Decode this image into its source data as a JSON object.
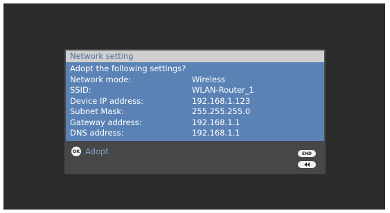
{
  "dialog": {
    "title": "Network setting",
    "question": "Adopt the following settings?",
    "rows": [
      {
        "label": "Network mode:",
        "value": "Wireless"
      },
      {
        "label": "SSID:",
        "value": "WLAN-Router_1"
      },
      {
        "label": "Device IP address:",
        "value": "192.168.1.123"
      },
      {
        "label": "Subnet Mask:",
        "value": "255.255.255.0"
      },
      {
        "label": "Gateway address:",
        "value": "192.168.1.1"
      },
      {
        "label": "DNS address:",
        "value": "192.168.1.1"
      }
    ]
  },
  "footer": {
    "ok_icon_label": "OK",
    "adopt_label": "Adopt",
    "end_label": "END",
    "back_icon": "rewind-back-icon"
  },
  "colors": {
    "screen_bg": "#2b2b2b",
    "dialog_bg": "#474747",
    "title_bg": "#cfcfcf",
    "title_text": "#4f6f9a",
    "content_bg": "#5b82b5",
    "adopt_text": "#7f9ec8"
  }
}
